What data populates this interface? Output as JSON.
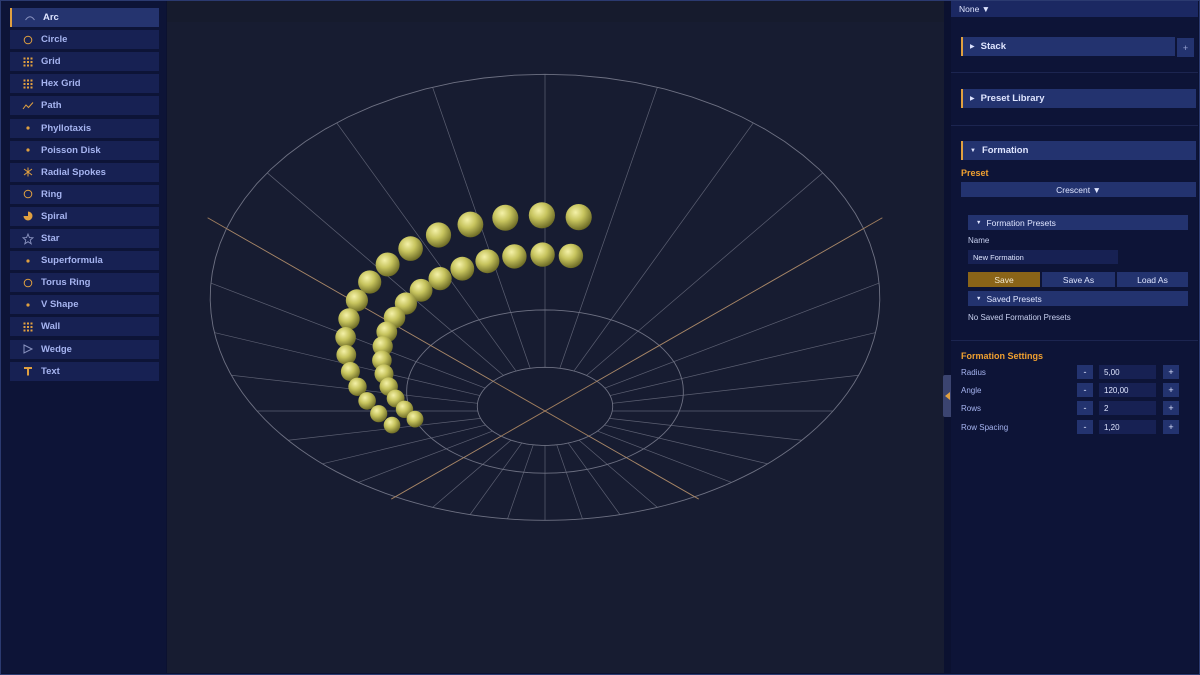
{
  "sidebar": {
    "items": [
      {
        "label": "Arc",
        "icon": "arc-icon",
        "active": true
      },
      {
        "label": "Circle",
        "icon": "circle-icon"
      },
      {
        "label": "Grid",
        "icon": "grid-icon"
      },
      {
        "label": "Hex Grid",
        "icon": "hex-grid-icon"
      },
      {
        "label": "Path",
        "icon": "path-icon"
      },
      {
        "label": "Phyllotaxis",
        "icon": "dot-icon"
      },
      {
        "label": "Poisson Disk",
        "icon": "dot-icon"
      },
      {
        "label": "Radial Spokes",
        "icon": "radial-spokes-icon"
      },
      {
        "label": "Ring",
        "icon": "ring-icon"
      },
      {
        "label": "Spiral",
        "icon": "spiral-icon"
      },
      {
        "label": "Star",
        "icon": "star-icon"
      },
      {
        "label": "Superformula",
        "icon": "dot-icon"
      },
      {
        "label": "Torus Ring",
        "icon": "torus-ring-icon"
      },
      {
        "label": "V Shape",
        "icon": "dot-icon"
      },
      {
        "label": "Wall",
        "icon": "wall-icon"
      },
      {
        "label": "Wedge",
        "icon": "wedge-icon"
      },
      {
        "label": "Text",
        "icon": "text-icon"
      }
    ]
  },
  "panel": {
    "top_select": "None ▼",
    "stack": {
      "title": "Stack",
      "expanded": false,
      "add_label": "+"
    },
    "preset_library": {
      "title": "Preset Library",
      "expanded": false
    },
    "formation": {
      "title": "Formation",
      "expanded": true,
      "preset_label": "Preset",
      "preset_value": "Crescent ▼",
      "formation_presets": {
        "title": "Formation Presets",
        "name_label": "Name",
        "name_value": "New Formation",
        "save_label": "Save",
        "save_as_label": "Save As",
        "load_as_label": "Load As",
        "saved_presets_title": "Saved Presets",
        "empty_text": "No Saved Formation Presets"
      },
      "settings_title": "Formation Settings",
      "settings": [
        {
          "label": "Radius",
          "value": "5,00"
        },
        {
          "label": "Angle",
          "value": "120,00"
        },
        {
          "label": "Rows",
          "value": "2"
        },
        {
          "label": "Row Spacing",
          "value": "1,20"
        }
      ],
      "decrement_label": "-",
      "increment_label": "+"
    }
  },
  "viewport": {
    "formation": "arc",
    "radius": 5.0,
    "angle_deg": 120,
    "rows": 2,
    "row_spacing": 1.2,
    "sphere_color": "#c7c45e",
    "grid_color": "#6e7183",
    "axis_color": "#b08a64"
  },
  "colors": {
    "accent": "#e0a040",
    "panel_bg": "#0d1437",
    "item_bg": "#172153",
    "active_bg": "#25346f",
    "viewport_bg": "#171c31"
  }
}
